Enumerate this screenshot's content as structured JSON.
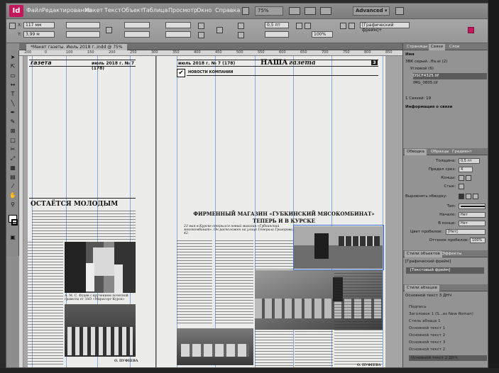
{
  "menubar": {
    "logo": "Id",
    "items": [
      "Файл",
      "Редактирование",
      "Макет",
      "Текст",
      "Объект",
      "Таблица",
      "Просмотр",
      "Окно",
      "Справка"
    ],
    "zoom": "75%",
    "workspace": "Advanced ▾"
  },
  "controlbar": {
    "x_label": "X:",
    "x_value": "117 мм",
    "y_label": "Y:",
    "y_value": "3,99 м",
    "stroke_weight": "0,5 пт",
    "frame_style": "[Графический фрейм]+",
    "zoom_field": "100%"
  },
  "document_tab": {
    "title": "*Макет газеты. Июль 2018 г..indd @ 75%"
  },
  "ruler": {
    "ticks": [
      "-200",
      "0",
      "100",
      "150",
      "200",
      "250",
      "300",
      "350",
      "400",
      "450",
      "500",
      "550",
      "600",
      "650",
      "700",
      "750",
      "800",
      "850"
    ]
  },
  "newspaper": {
    "left_header_title": "газета",
    "left_header_date": "июль 2018 г. № 7 (178)",
    "right_header_date": "июль 2018 г. № 7 (178)",
    "right_header_title": "НАША",
    "right_header_title_script": "газета",
    "page_number": "3",
    "section_label": "НОВОСТИ КОМПАНИИ",
    "left_article_title": "ОСТАЁТСЯ МОЛОДЫМ",
    "main_article_title": "ФИРМЕННЫЙ МАГАЗИН «ГУБКИНСКИЙ МЯСОКОМБИНАТ»",
    "main_article_subtitle": "ТЕПЕРЬ И В КУРСКЕ",
    "main_article_lead": "23 мая в Курске открылся новый магазин «Губкинский мясокомбинат». Он расположен на улице Генерала Григорова, дом 42.",
    "left_caption": "А. М. С. Фуцев с вручением почетной грамоты от ЗАО «Мираторг-Курск»",
    "left_signature": "О. ПУФЕЕВА",
    "main_signature": "О. ПУФЕЕВА"
  },
  "links_panel": {
    "tabs": [
      "Страницы",
      "Связи",
      "Слои"
    ],
    "column_name": "Имя",
    "items": [
      "ЗВК серый...ffa.ai (2)",
      "Угловой (6)",
      "DSCF4325.tif",
      "IMG_0805.tif"
    ],
    "selected_count": "1 Связей: 19",
    "info_label": "Информация о связи"
  },
  "stroke_panel": {
    "tabs": [
      "Обводка",
      "Образцы",
      "Градиент"
    ],
    "weight_label": "Толщина:",
    "weight_value": "0,5 пт",
    "miter_label": "Предел срез:",
    "miter_value": "4",
    "ends_label": "Концы:",
    "joins_label": "Стык:",
    "align_label": "Выровнять обводку:",
    "type_label": "Тип:",
    "start_label": "Начало:",
    "start_value": "Нет",
    "end_label": "В конце:",
    "end_value": "Нет",
    "gap_color_label": "Цвет пробелов:",
    "gap_color_value": "[Нет]",
    "gap_tint_label": "Оттенок пробелов:",
    "gap_tint_value": "100%"
  },
  "object_styles_panel": {
    "tabs": [
      "Стили объектов",
      "Эффекты"
    ],
    "current": "[Графический фрейм]",
    "items": [
      "[Текстовый фрейм]"
    ]
  },
  "paragraph_styles_panel": {
    "title": "Стили абзацев",
    "current": "Основной текст 3 ДНЧ",
    "items": [
      "Подпись",
      "Заголовок 1 (S...es New Roman)",
      "Стиль абзаца 1",
      "Основной текст 1",
      "Основной текст 2",
      "Основной текст 3",
      "Основной текст 2",
      "Основной текст 2 ДНЧ"
    ]
  },
  "colors": {
    "app_chrome": "#8d8d8d",
    "guide_blue": "#8aa9d9",
    "logo_magenta": "#c2185b",
    "selection_frame": "#3b6fd6"
  }
}
